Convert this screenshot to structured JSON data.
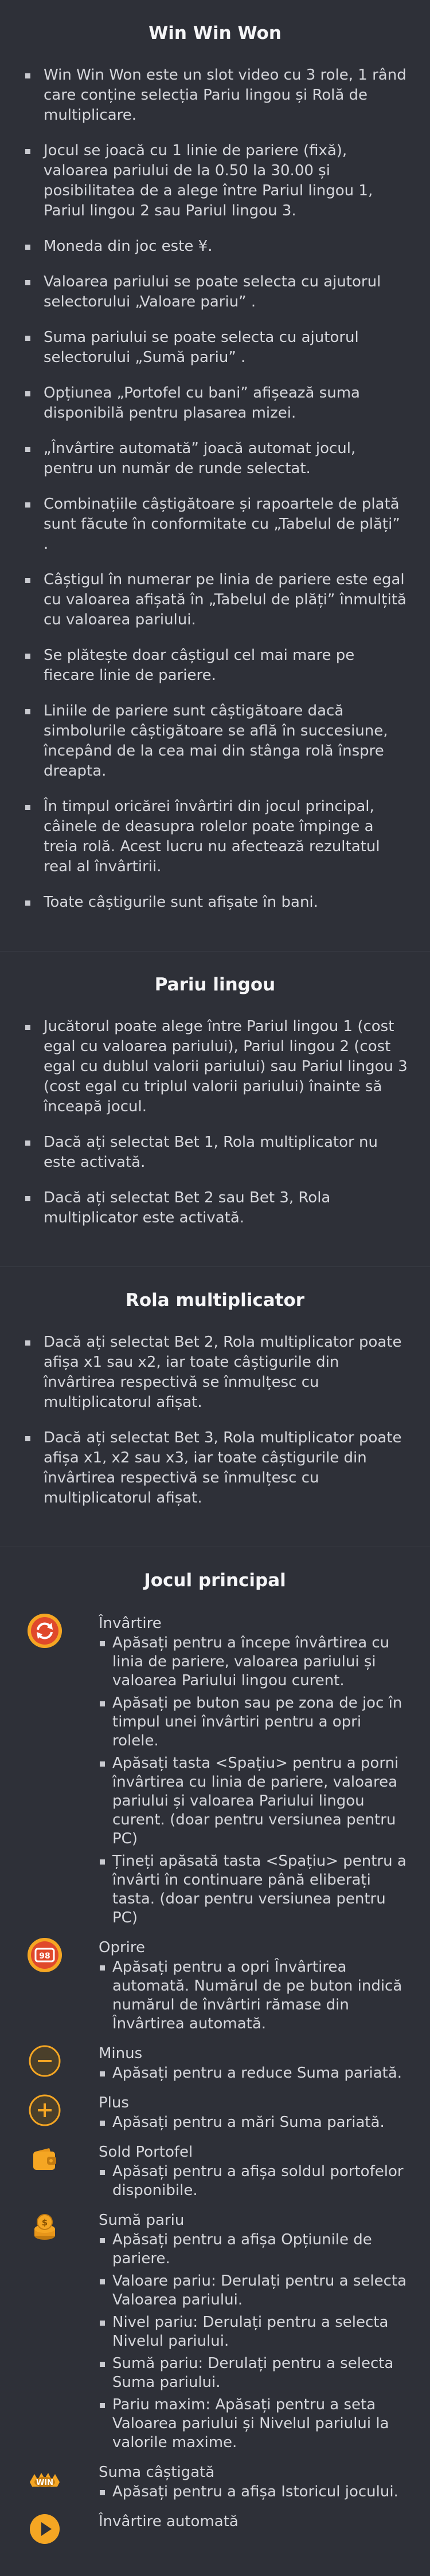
{
  "intro": {
    "title": "Win Win Won",
    "rules": [
      "Win Win Won este un slot video cu 3 role, 1 rând care conține selecția Pariu lingou și Rolă de multiplicare.",
      "Jocul se joacă cu 1 linie de pariere (fixă), valoarea pariului de la 0.50 la 30.00 și posibilitatea de a alege între Pariul lingou 1, Pariul lingou 2 sau Pariul lingou 3.",
      "Moneda din joc este ¥.",
      "Valoarea pariului se poate selecta cu ajutorul selectorului „Valoare pariu” .",
      "Suma pariului se poate selecta cu ajutorul selectorului „Sumă pariu” .",
      "Opțiunea „Portofel cu bani” afișează suma disponibilă pentru plasarea mizei.",
      "„Învârtire automată” joacă automat jocul, pentru un număr de runde selectat.",
      "Combinațiile câștigătoare și rapoartele de plată sunt făcute în conformitate cu „Tabelul de plăți” .",
      "Câștigul în numerar pe linia de pariere este egal cu valoarea afișată în „Tabelul de plăți” înmulțită cu valoarea pariului.",
      "Se plătește doar câștigul cel mai mare pe fiecare linie de pariere.",
      "Liniile de pariere sunt câștigătoare dacă simbolurile câștigătoare se află în succesiune, începând de la cea mai din stânga rolă înspre dreapta.",
      "În timpul oricărei învârtiri din jocul principal, câinele de deasupra rolelor poate împinge a treia rolă. Acest lucru nu afectează rezultatul real al învârtirii.",
      "Toate câștigurile sunt afișate în bani."
    ]
  },
  "bullion": {
    "title": "Pariu lingou",
    "rules": [
      "Jucătorul poate alege între Pariul lingou 1 (cost egal cu valoarea pariului), Pariul lingou 2 (cost egal cu dublul valorii pariului) sau Pariul lingou 3 (cost egal cu triplul valorii pariului) înainte să înceapă jocul.",
      "Dacă ați selectat Bet 1, Rola multiplicator nu este activată.",
      "Dacă ați selectat Bet 2 sau Bet 3, Rola multiplicator este activată."
    ]
  },
  "multiplier": {
    "title": "Rola multiplicator",
    "rules": [
      "Dacă ați selectat Bet 2, Rola multiplicator poate afișa x1 sau x2, iar toate câștigurile din învârtirea respectivă se înmulțesc cu multiplicatorul afișat.",
      "Dacă ați selectat Bet 3, Rola multiplicator poate afișa x1, x2 sau x3, iar toate câștigurile din învârtirea respectivă se înmulțesc cu multiplicatorul afișat."
    ]
  },
  "main_game": {
    "title": "Jocul principal",
    "controls": [
      {
        "icon": "spin-icon",
        "name": "Învârtire",
        "items": [
          "Apăsați pentru a începe învârtirea cu linia de pariere, valoarea pariului și valoarea Pariului lingou curent.",
          "Apăsați pe buton sau pe zona de joc în timpul unei învârtiri pentru a opri rolele.",
          "Apăsați tasta <Spațiu> pentru a porni învârtirea cu linia de pariere, valoarea pariului și valoarea Pariului lingou curent. (doar pentru versiunea pentru PC)",
          "Țineți apăsată tasta <Spațiu> pentru a învârti în continuare până eliberați tasta. (doar pentru versiunea pentru PC)"
        ]
      },
      {
        "icon": "stop-icon",
        "icon_text": "98",
        "name": "Oprire",
        "items": [
          "Apăsați pentru a opri Învârtirea automată. Numărul de pe buton indică numărul de învârtiri rămase din Învârtirea automată."
        ]
      },
      {
        "icon": "minus-icon",
        "name": "Minus",
        "items": [
          "Apăsați pentru a reduce Suma pariată."
        ]
      },
      {
        "icon": "plus-icon",
        "name": "Plus",
        "items": [
          "Apăsați pentru a mări Suma pariată."
        ]
      },
      {
        "icon": "wallet-icon",
        "name": "Sold Portofel",
        "items": [
          "Apăsați pentru a afișa soldul portofelor disponibile."
        ]
      },
      {
        "icon": "coins-icon",
        "name": "Sumă pariu",
        "items": [
          "Apăsați pentru a afișa Opțiunile de pariere.",
          "Valoare pariu: Derulați pentru a selecta Valoarea pariului.",
          "Nivel pariu: Derulați pentru a selecta Nivelul pariului.",
          "Sumă pariu: Derulați pentru a selecta Suma pariului.",
          "Pariu maxim: Apăsați pentru a seta Valoarea pariului și Nivelul pariului la valorile maxime."
        ]
      },
      {
        "icon": "win-icon",
        "icon_text": "WIN",
        "name": "Suma câștigată",
        "items": [
          "Apăsați pentru a afișa Istoricul jocului."
        ]
      },
      {
        "icon": "autospin-icon",
        "name": "Învârtire automată",
        "items": []
      }
    ]
  },
  "colors": {
    "background": "#2e3038",
    "accent": "#f5a623",
    "spin": "#e0492b"
  }
}
